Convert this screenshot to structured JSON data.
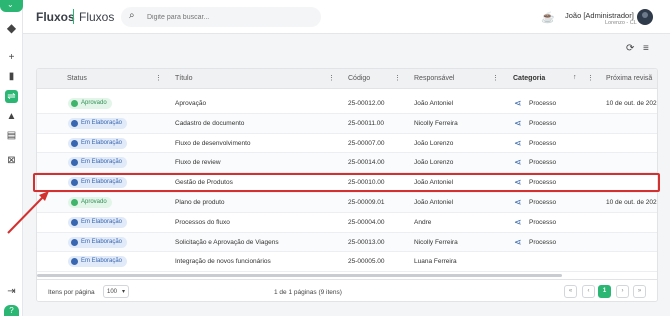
{
  "header": {
    "title": "Fluxos",
    "subtitle": "Fluxos",
    "search_placeholder": "Digite para buscar...",
    "user_name": "João [Administrador]",
    "user_org": "Lorenzo - CL"
  },
  "table": {
    "columns": [
      {
        "label": "Status"
      },
      {
        "label": "Título"
      },
      {
        "label": "Código"
      },
      {
        "label": "Responsável"
      },
      {
        "label": "Categoria",
        "sort": "↑"
      },
      {
        "label": "Próxima revisã"
      }
    ],
    "rows": [
      {
        "status": "Aprovado",
        "status_color": "green",
        "title": "Aprovação",
        "code": "25-00012.00",
        "owner": "João Antoniel",
        "category": "Processo",
        "next_review": "10 de out. de 202"
      },
      {
        "status": "Em Elaboração",
        "status_color": "blue",
        "title": "Cadastro de documento",
        "code": "25-00011.00",
        "owner": "Nicolly Ferreira",
        "category": "Processo",
        "next_review": ""
      },
      {
        "status": "Em Elaboração",
        "status_color": "blue",
        "title": "Fluxo de desenvolvimento",
        "code": "25-00007.00",
        "owner": "João Lorenzo",
        "category": "Processo",
        "next_review": ""
      },
      {
        "status": "Em Elaboração",
        "status_color": "blue",
        "title": "Fluxo de review",
        "code": "25-00014.00",
        "owner": "João Lorenzo",
        "category": "Processo",
        "next_review": ""
      },
      {
        "status": "Em Elaboração",
        "status_color": "blue",
        "title": "Gestão de Produtos",
        "code": "25-00010.00",
        "owner": "João Antoniel",
        "category": "Processo",
        "next_review": ""
      },
      {
        "status": "Aprovado",
        "status_color": "green",
        "title": "Plano de produto",
        "code": "25-00009.01",
        "owner": "João Antoniel",
        "category": "Processo",
        "next_review": "10 de out. de 202"
      },
      {
        "status": "Em Elaboração",
        "status_color": "blue",
        "title": "Processos do fluxo",
        "code": "25-00004.00",
        "owner": "Andre",
        "category": "Processo",
        "next_review": ""
      },
      {
        "status": "Em Elaboração",
        "status_color": "blue",
        "title": "Solicitação e Aprovação de Viagens",
        "code": "25-00013.00",
        "owner": "Nicolly Ferreira",
        "category": "Processo",
        "next_review": ""
      },
      {
        "status": "Em Elaboração",
        "status_color": "blue",
        "title": "Integração de novos funcionários",
        "code": "25-00005.00",
        "owner": "Luana Ferreira",
        "category": "",
        "next_review": ""
      }
    ]
  },
  "footer": {
    "items_per_page_label": "Itens por página",
    "items_per_page_value": "100",
    "page_info": "1 de 1 páginas (9 itens)",
    "current_page": "1"
  },
  "colors": {
    "accent": "#2bb673",
    "highlight": "#d3302f",
    "approved": "#3fb56b",
    "in_progress": "#3866b0"
  },
  "icons": [
    "logo-icon",
    "plus-icon",
    "dashboard-icon",
    "flow-icon",
    "sitemap-icon",
    "document-icon",
    "grid-icon",
    "collapse-icon",
    "help-icon",
    "search-icon",
    "coffee-icon",
    "refresh-icon",
    "filter-icon",
    "share-icon"
  ]
}
